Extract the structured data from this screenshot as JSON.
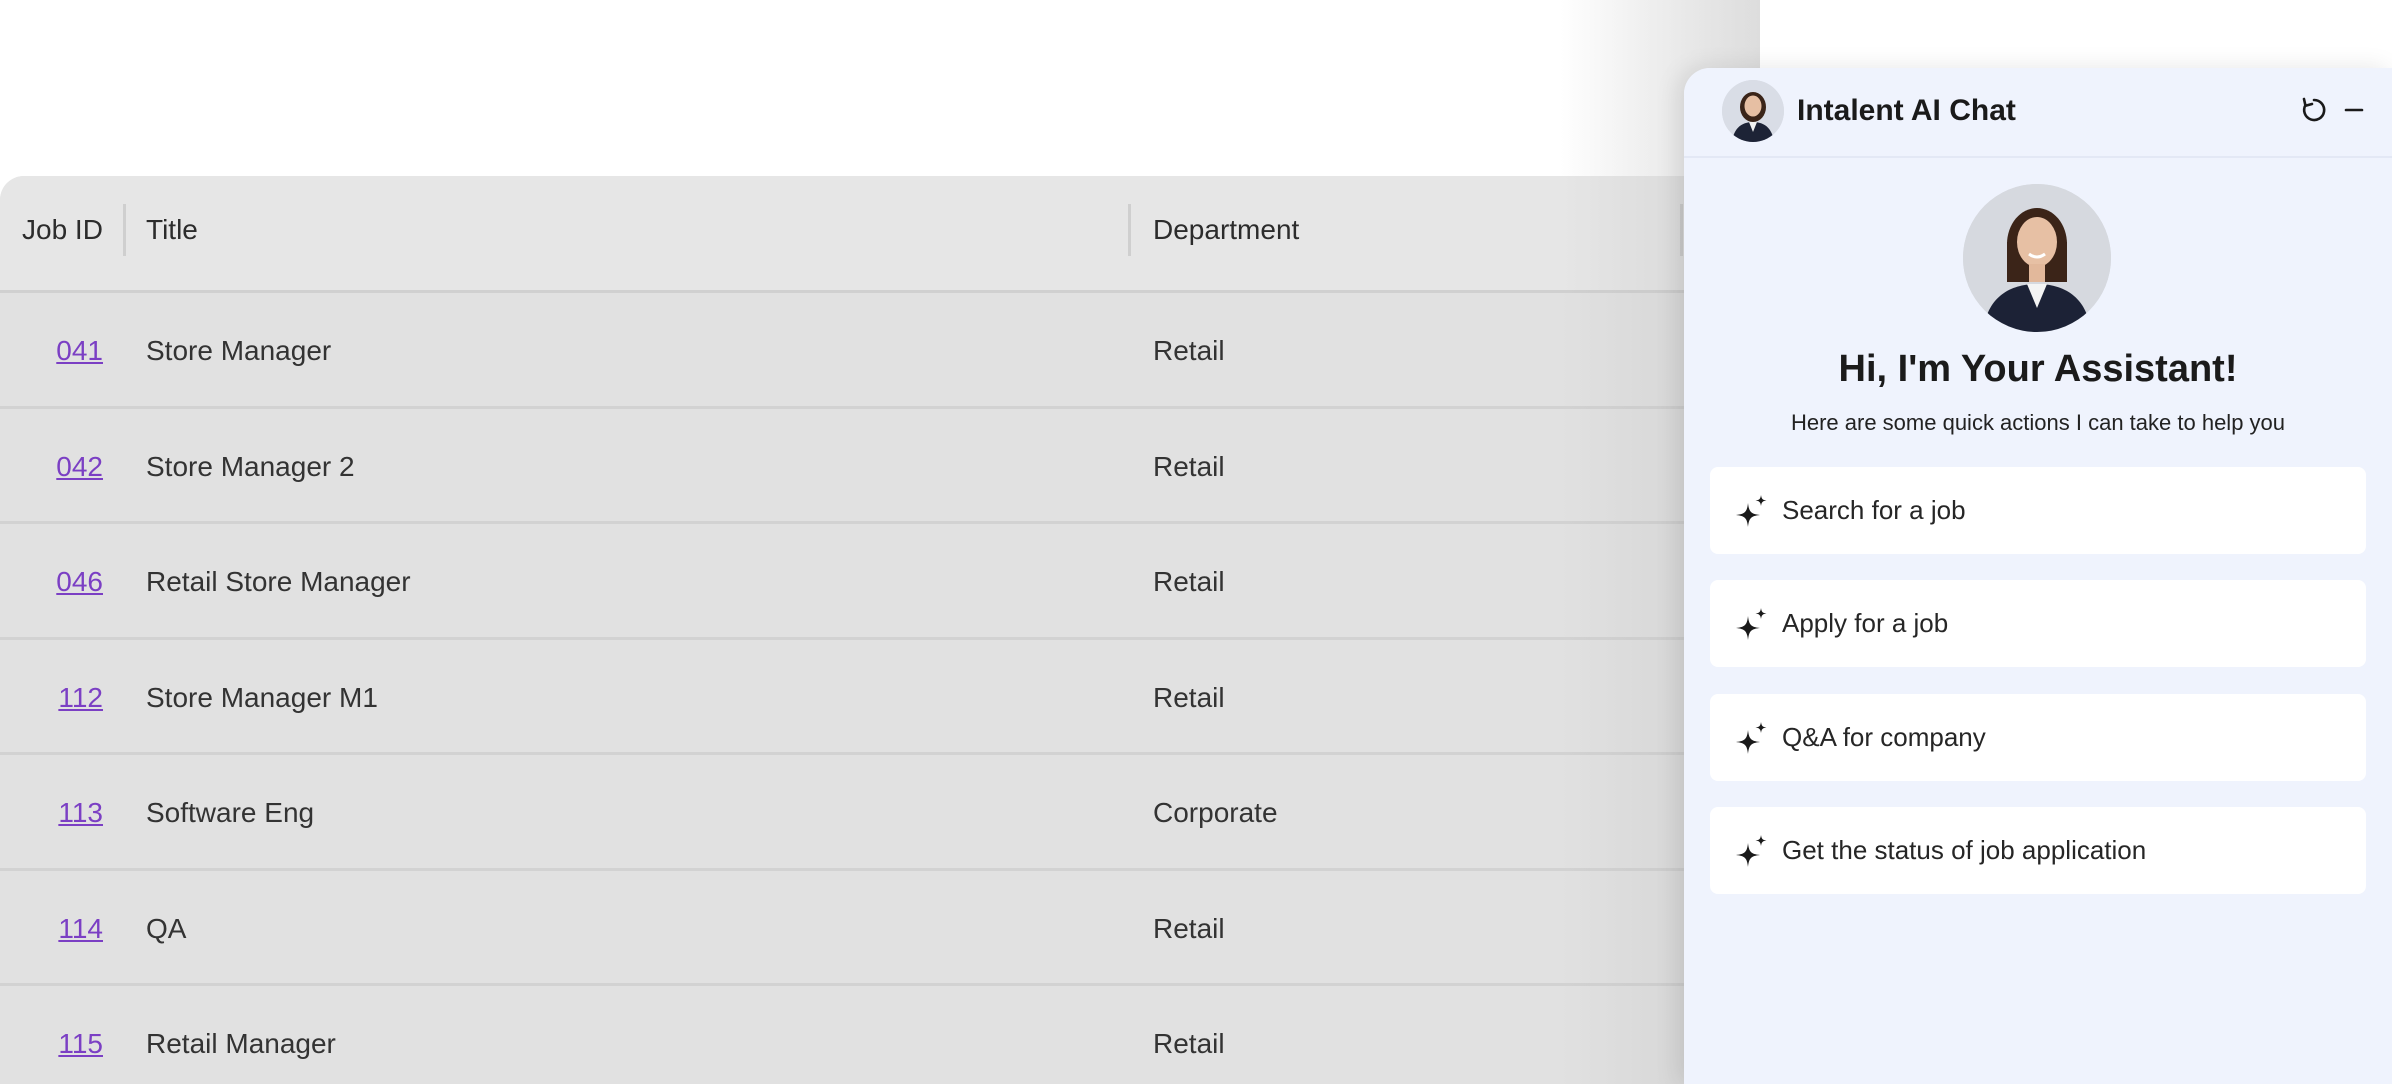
{
  "table": {
    "headers": {
      "job_id": "Job ID",
      "title": "Title",
      "department": "Department"
    },
    "rows": [
      {
        "id": "041",
        "title": "Store Manager",
        "department": "Retail"
      },
      {
        "id": "042",
        "title": "Store Manager 2",
        "department": "Retail"
      },
      {
        "id": "046",
        "title": "Retail Store Manager",
        "department": "Retail"
      },
      {
        "id": "112",
        "title": "Store Manager M1",
        "department": "Retail"
      },
      {
        "id": "113",
        "title": "Software Eng",
        "department": "Corporate"
      },
      {
        "id": "114",
        "title": "QA",
        "department": "Retail"
      },
      {
        "id": "115",
        "title": "Retail Manager",
        "department": "Retail"
      }
    ]
  },
  "chat": {
    "title": "Intalent AI Chat",
    "greeting": "Hi, I'm Your Assistant!",
    "subtitle": "Here are some quick actions I can take to help you",
    "actions": [
      {
        "label": "Search for a job",
        "icon": "sparkle-icon"
      },
      {
        "label": "Apply for a job",
        "icon": "sparkle-icon"
      },
      {
        "label": "Q&A for company",
        "icon": "sparkle-icon"
      },
      {
        "label": "Get the status of job application",
        "icon": "sparkle-icon"
      }
    ],
    "header_icons": [
      "refresh-icon",
      "minimize-icon"
    ]
  },
  "colors": {
    "panel_bg": "#eff3fd",
    "link": "#7b3fc4",
    "table_bg": "#e1e1e1"
  }
}
